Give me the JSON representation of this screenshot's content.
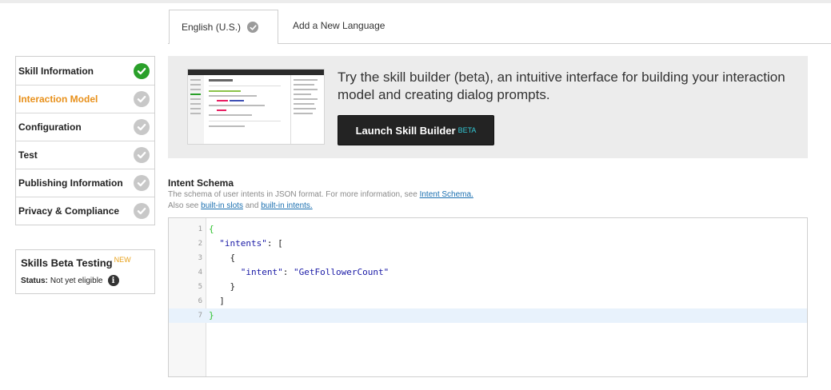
{
  "tabs": {
    "active_label": "English (U.S.)",
    "add_label": "Add a New Language"
  },
  "nav": {
    "items": [
      {
        "label": "Skill Information",
        "status": "complete"
      },
      {
        "label": "Interaction Model",
        "status": "current"
      },
      {
        "label": "Configuration",
        "status": "incomplete"
      },
      {
        "label": "Test",
        "status": "incomplete"
      },
      {
        "label": "Publishing Information",
        "status": "incomplete"
      },
      {
        "label": "Privacy & Compliance",
        "status": "incomplete"
      }
    ]
  },
  "beta_testing": {
    "title": "Skills Beta Testing",
    "badge": "NEW",
    "status_label": "Status:",
    "status_value": "Not yet eligible"
  },
  "banner": {
    "text": "Try the skill builder (beta), an intuitive interface for building your interaction model and creating dialog prompts.",
    "button_label": "Launch Skill Builder",
    "button_badge": "BETA"
  },
  "schema": {
    "title": "Intent Schema",
    "help_1": "The schema of user intents in JSON format. For more information, see ",
    "help_link_1": "Intent Schema.",
    "help_2": "Also see ",
    "help_link_2": "built-in slots",
    "help_and": " and ",
    "help_link_3": "built-in intents."
  },
  "editor": {
    "line_numbers": [
      "1",
      "2",
      "3",
      "4",
      "5",
      "6",
      "7"
    ],
    "lines": {
      "l1": "{",
      "l2_key": "\"intents\"",
      "l2_rest": ": [",
      "l3": "{",
      "l4_key": "\"intent\"",
      "l4_sep": ": ",
      "l4_val": "\"GetFollowerCount\"",
      "l5": "}",
      "l6": "]",
      "l7": "}"
    }
  },
  "colors": {
    "accent_current": "#e8901a",
    "complete_green": "#2aa02a",
    "beta_badge": "#33c9d6"
  }
}
